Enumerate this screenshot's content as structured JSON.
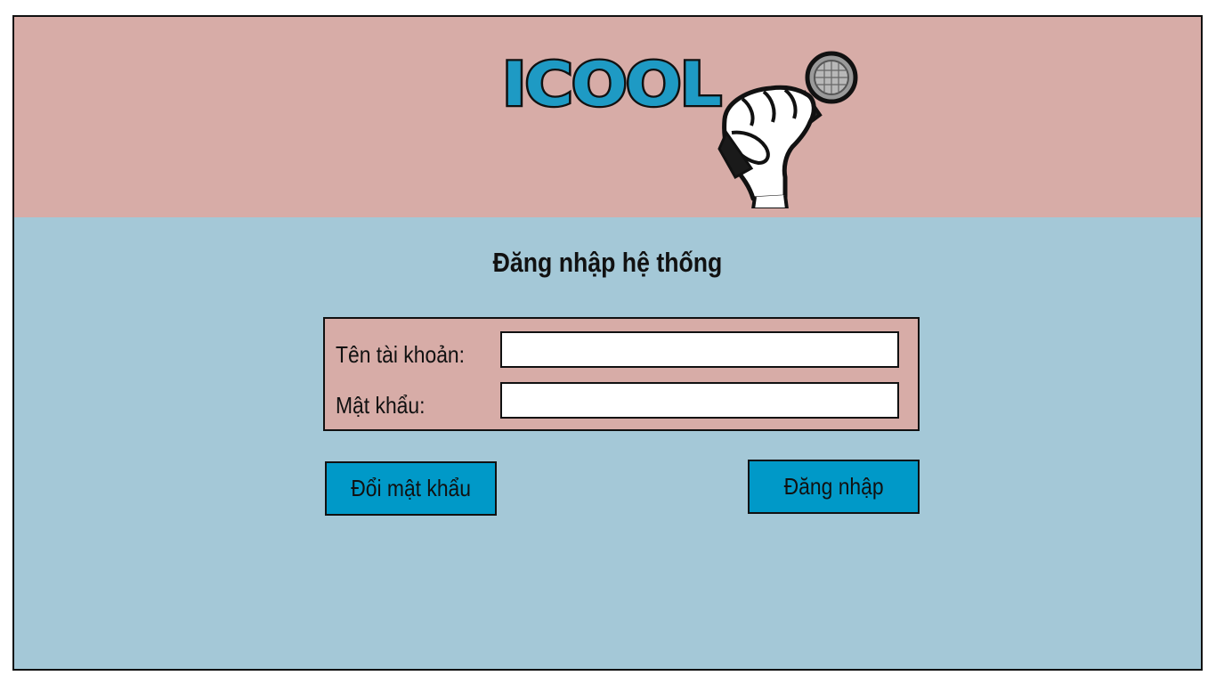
{
  "app": {
    "logo_text": "ICOOL",
    "logo_icon": "microphone-hand-icon",
    "colors": {
      "header_bg": "#d7aca7",
      "body_bg": "#a4c8d7",
      "accent": "#0099c8",
      "logo_blue": "#1e9ac4"
    }
  },
  "main": {
    "title": "Đăng nhập hệ thống"
  },
  "form": {
    "username_label": "Tên tài khoản:",
    "username_value": "",
    "password_label": "Mật khẩu:",
    "password_value": ""
  },
  "buttons": {
    "change_password": "Đổi mật khẩu",
    "login": "Đăng nhập"
  }
}
